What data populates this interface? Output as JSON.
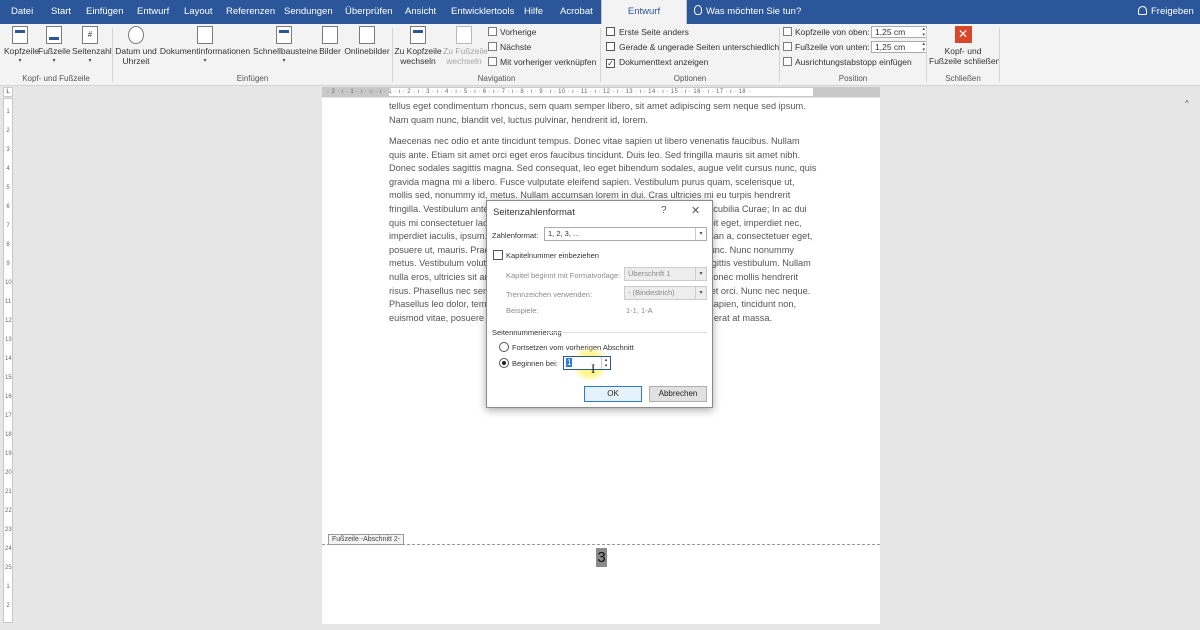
{
  "ribbon_tabs": [
    "Datei",
    "Start",
    "Einfügen",
    "Entwurf",
    "Layout",
    "Referenzen",
    "Sendungen",
    "Überprüfen",
    "Ansicht",
    "Entwicklertools",
    "Hilfe",
    "Acrobat",
    "Entwurf"
  ],
  "tell_me": "Was möchten Sie tun?",
  "share": "Freigeben",
  "ribbon": {
    "kopfzeile": "Kopfzeile",
    "fusszeile": "Fußzeile",
    "seitenzahl": "Seitenzahl",
    "group_kopf_fuss": "Kopf- und Fußzeile",
    "datum_uhrzeit_1": "Datum und",
    "datum_uhrzeit_2": "Uhrzeit",
    "dokumentinfo": "Dokumentinformationen",
    "schnellbausteine": "Schnellbausteine",
    "bilder": "Bilder",
    "onlinebilder": "Onlinebilder",
    "group_einfuegen": "Einfügen",
    "zu_kopfzeile_1": "Zu Kopfzeile",
    "zu_kopfzeile_2": "wechseln",
    "zu_fusszeile_1": "Zu Fußzeile",
    "zu_fusszeile_2": "wechseln",
    "vorherige": "Vorherige",
    "naechste": "Nächste",
    "verknuepfen": "Mit vorheriger verknüpfen",
    "group_navigation": "Navigation",
    "erste_seite": "Erste Seite anders",
    "gerade_ungerade": "Gerade & ungerade Seiten unterschiedlich",
    "dokumenttext": "Dokumenttext anzeigen",
    "dokumenttext_check": "✓",
    "group_optionen": "Optionen",
    "kopf_oben": "Kopfzeile von oben:",
    "kopf_oben_val": "1,25 cm",
    "fuss_unten": "Fußzeile von unten:",
    "fuss_unten_val": "1,25 cm",
    "ausrichtung": "Ausrichtungstabstopp einfügen",
    "group_position": "Position",
    "schliessen_1": "Kopf- und",
    "schliessen_2": "Fußzeile schließen",
    "schliessen_x": "✕",
    "group_schliessen": "Schließen"
  },
  "ruler_ticks": "· 2 · ı · 1 · ı · ⌂ · ı · 1 · ı · 2 · ı · 3 · ı · 4 · ı · 5 · ı · 6 · ı · 7 · ı · 8 · ı · 9 · ı · 10 · ı · 11 · ı · 12 · ı · 13 · ı · 14 · ı · 15 · ı · 16 · ı · 17 · ı · 18 ·",
  "document": {
    "para1": "tellus eget condimentum rhoncus, sem quam semper libero, sit amet adipiscing sem neque sed ipsum. Nam quam nunc, blandit vel, luctus pulvinar, hendrerit id, lorem.",
    "para2": "Maecenas nec odio et ante tincidunt tempus. Donec vitae sapien ut libero venenatis faucibus. Nullam quis ante. Etiam sit amet orci eget eros faucibus tincidunt. Duis leo. Sed fringilla mauris sit amet nibh. Donec sodales sagittis magna. Sed consequat, leo eget bibendum sodales, augue velit cursus nunc, quis gravida magna mi a libero. Fusce vulputate eleifend sapien. Vestibulum purus quam, scelerisque ut, mollis sed, nonummy id, metus. Nullam accumsan lorem in dui. Cras ultricies mi eu turpis hendrerit fringilla. Vestibulum ante ipsum primis in faucibus orci luctus et ultrices posuere cubilia Curae; In ac dui quis mi consectetuer lacinia. Nam pretium turpis et arcu. Duis arcu tortor, suscipit eget, imperdiet nec, imperdiet iaculis, ipsum. Sed aliquam ultrices mauris. Integer ante arcu, accumsan a, consectetuer eget, posuere ut, mauris. Praesent adipiscing. Phasellus ullamcorper ipsum rutrum nunc. Nunc nonummy metus. Vestibulum volutpat pretium libero. Cras id dui. Aenean ut eros et nisl sagittis vestibulum. Nullam nulla eros, ultricies sit amet, nonummy id, imperdiet feugiat, pede. Sed lectus. Donec mollis hendrerit risus. Phasellus nec sem in justo pellentesque facilisis. Etiam imperdiet imperdiet orci. Nunc nec neque. Phasellus leo dolor, tempus non, auctor et, hendrerit quis, nisi. Curabitur ligula sapien, tincidunt non, euismod vitae, posuere imperdiet, leo. Maecenas malesuada. Praesent congue erat at massa.",
    "footer_tag": "Fußzeile -Abschnitt 2-",
    "page_number": "3"
  },
  "dialog": {
    "title": "Seitenzahlenformat",
    "help": "?",
    "close": "✕",
    "zahlenformat_label": "Zahlenformat:",
    "zahlenformat_value": "1, 2, 3, ...",
    "kapitelnummer": "Kapitelnummer einbeziehen",
    "kapitel_beginnt": "Kapitel beginnt mit Formatvorlage:",
    "kapitel_beginnt_value": "Überschrift 1",
    "trennzeichen": "Trennzeichen verwenden:",
    "trennzeichen_value": "-     (Bindestrich)",
    "beispiele": "Beispiele:",
    "beispiele_value": "1-1, 1-A",
    "seitennummerierung": "Seitennummerierung",
    "fortsetzen": "Fortsetzen vom vorherigen Abschnitt",
    "beginnen_bei": "Beginnen bei:",
    "beginnen_value": "1",
    "ok": "OK",
    "abbrechen": "Abbrechen"
  },
  "colors": {
    "accent": "#2b579a",
    "close_red": "#d9472b",
    "highlight": "#fff55a"
  }
}
